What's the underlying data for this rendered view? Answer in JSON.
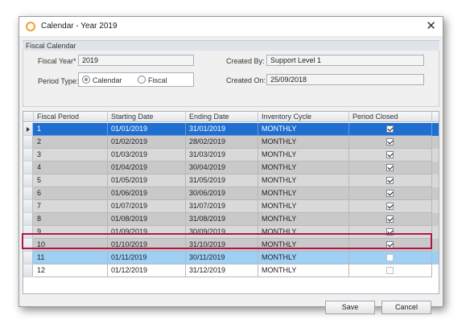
{
  "window": {
    "title": "Calendar - Year 2019",
    "close_glyph": "✕"
  },
  "group": {
    "title": "Fiscal Calendar",
    "fiscal_year_label": "Fiscal Year*",
    "fiscal_year_value": "2019",
    "period_type_label": "Period Type:",
    "period_options": [
      "Calendar",
      "Fiscal"
    ],
    "period_selected": "Calendar",
    "created_by_label": "Created By:",
    "created_by_value": "Support Level 1",
    "created_on_label": "Created On:",
    "created_on_value": "25/09/2018"
  },
  "grid": {
    "columns": [
      "Fiscal Period",
      "Starting Date",
      "Ending Date",
      "Inventory Cycle",
      "Period Closed"
    ],
    "rows": [
      {
        "period": "1",
        "start": "01/01/2019",
        "end": "31/01/2019",
        "cycle": "MONTHLY",
        "closed": true
      },
      {
        "period": "2",
        "start": "01/02/2019",
        "end": "28/02/2019",
        "cycle": "MONTHLY",
        "closed": true
      },
      {
        "period": "3",
        "start": "01/03/2019",
        "end": "31/03/2019",
        "cycle": "MONTHLY",
        "closed": true
      },
      {
        "period": "4",
        "start": "01/04/2019",
        "end": "30/04/2019",
        "cycle": "MONTHLY",
        "closed": true
      },
      {
        "period": "5",
        "start": "01/05/2019",
        "end": "31/05/2019",
        "cycle": "MONTHLY",
        "closed": true
      },
      {
        "period": "6",
        "start": "01/06/2019",
        "end": "30/06/2019",
        "cycle": "MONTHLY",
        "closed": true
      },
      {
        "period": "7",
        "start": "01/07/2019",
        "end": "31/07/2019",
        "cycle": "MONTHLY",
        "closed": true
      },
      {
        "period": "8",
        "start": "01/08/2019",
        "end": "31/08/2019",
        "cycle": "MONTHLY",
        "closed": true
      },
      {
        "period": "9",
        "start": "01/09/2019",
        "end": "30/09/2019",
        "cycle": "MONTHLY",
        "closed": true
      },
      {
        "period": "10",
        "start": "01/10/2019",
        "end": "31/10/2019",
        "cycle": "MONTHLY",
        "closed": true
      },
      {
        "period": "11",
        "start": "01/11/2019",
        "end": "30/11/2019",
        "cycle": "MONTHLY",
        "closed": false
      },
      {
        "period": "12",
        "start": "01/12/2019",
        "end": "31/12/2019",
        "cycle": "MONTHLY",
        "closed": false
      }
    ],
    "selected_row": "1",
    "focused_row": "11"
  },
  "buttons": {
    "save": "Save",
    "cancel": "Cancel"
  },
  "colors": {
    "selection": "#1f6fd1",
    "focus_row": "#9ecff5",
    "highlight_border": "#b0154f",
    "app_icon": "#f0a030"
  },
  "icons": {
    "app": "circle-app-icon",
    "close": "close-icon",
    "row_indicator": "row-pointer-icon"
  }
}
